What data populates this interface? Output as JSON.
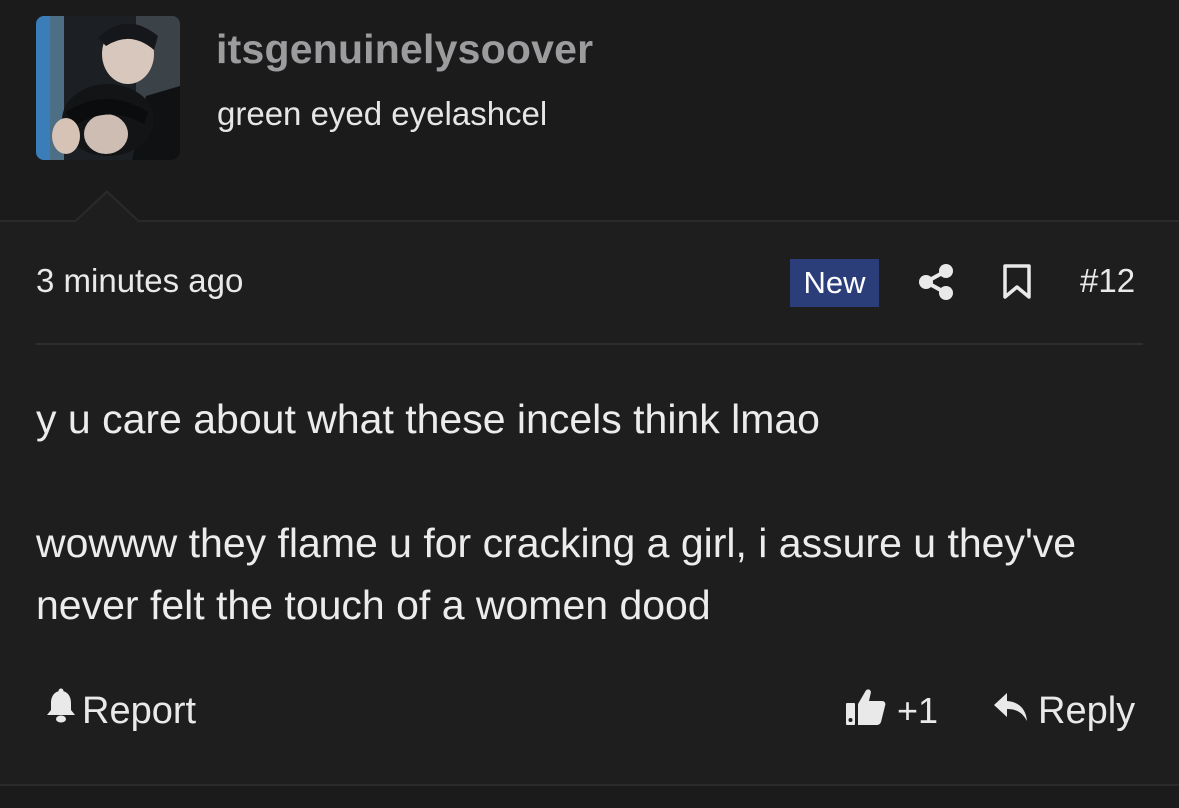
{
  "user": {
    "name": "itsgenuinelysoover",
    "title": "green eyed eyelashcel"
  },
  "post": {
    "time": "3 minutes ago",
    "badge": "New",
    "number": "#12",
    "paragraphs": [
      "y u care about what these incels think lmao",
      "wowww they flame u for cracking a girl, i assure u they've never felt the touch of a women dood"
    ]
  },
  "actions": {
    "report_label": "Report",
    "like_count": "+1",
    "reply_label": "Reply"
  },
  "colors": {
    "background": "#1e1e1f",
    "badge": "#2b3e7a",
    "username": "#9c9c9e"
  },
  "icons": [
    "share-icon",
    "bookmark-icon",
    "bell-icon",
    "thumbs-up-icon",
    "reply-arrow-icon"
  ]
}
